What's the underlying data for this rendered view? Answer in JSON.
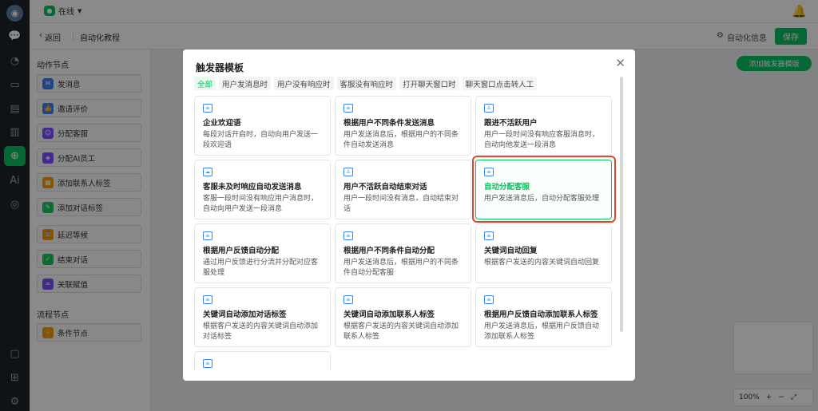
{
  "topbar": {
    "status": "在线"
  },
  "subbar": {
    "back": "返回",
    "breadcrumb": "自动化教程",
    "auto_info": "自动化信息",
    "save": "保存"
  },
  "panel": {
    "action_section": "动作节点",
    "actions": [
      "发消息",
      "邀请评价",
      "分配客服",
      "分配AI员工",
      "添加联系人标签",
      "添加对话标签",
      "延迟等候",
      "结束对话",
      "关联赋值"
    ],
    "flow_section": "流程节点",
    "flows": [
      "条件节点"
    ]
  },
  "canvas": {
    "add_trigger": "添加触发器模版",
    "zoom": "100%"
  },
  "modal": {
    "title": "触发器模板",
    "tabs": [
      "全部",
      "用户发消息时",
      "用户没有响应时",
      "客服没有响应时",
      "打开聊天窗口时",
      "聊天窗口点击转人工"
    ],
    "cards": [
      {
        "title": "企业欢迎语",
        "desc": "每段对话开启时，自动向用户发送一段欢迎语"
      },
      {
        "title": "根据用户不同条件发送消息",
        "desc": "用户发送消息后，根据用户的不同条件自动发送消息"
      },
      {
        "title": "跟进不活跃用户",
        "desc": "用户一段时间没有响应客服消息时，自动向他发送一段消息"
      },
      {
        "title": "客服未及时响应自动发送消息",
        "desc": "客服一段时间没有响应用户消息时，自动向用户发送一段消息"
      },
      {
        "title": "用户不活跃自动结束对话",
        "desc": "用户一段时间没有消息，自动结束对话"
      },
      {
        "title": "自动分配客服",
        "desc": "用户发送消息后，自动分配客服处理"
      },
      {
        "title": "根据用户反馈自动分配",
        "desc": "通过用户反馈进行分流并分配对应客服处理"
      },
      {
        "title": "根据用户不同条件自动分配",
        "desc": "用户发送消息后，根据用户的不同条件自动分配客服"
      },
      {
        "title": "关键词自动回复",
        "desc": "根据客户发送的内容关键词自动回复"
      },
      {
        "title": "关键词自动添加对话标签",
        "desc": "根据客户发送的内容关键词自动添加对话标签"
      },
      {
        "title": "关键词自动添加联系人标签",
        "desc": "根据客户发送的内容关键词自动添加联系人标签"
      },
      {
        "title": "根据用户反馈自动添加联系人标签",
        "desc": "用户发送消息后，根据用户反馈自动添加联系人标签"
      },
      {
        "title": "",
        "desc": ""
      }
    ]
  },
  "colors": {
    "accent": "#07c160",
    "highlight": "#e0492f",
    "rail": "#1f2329"
  }
}
